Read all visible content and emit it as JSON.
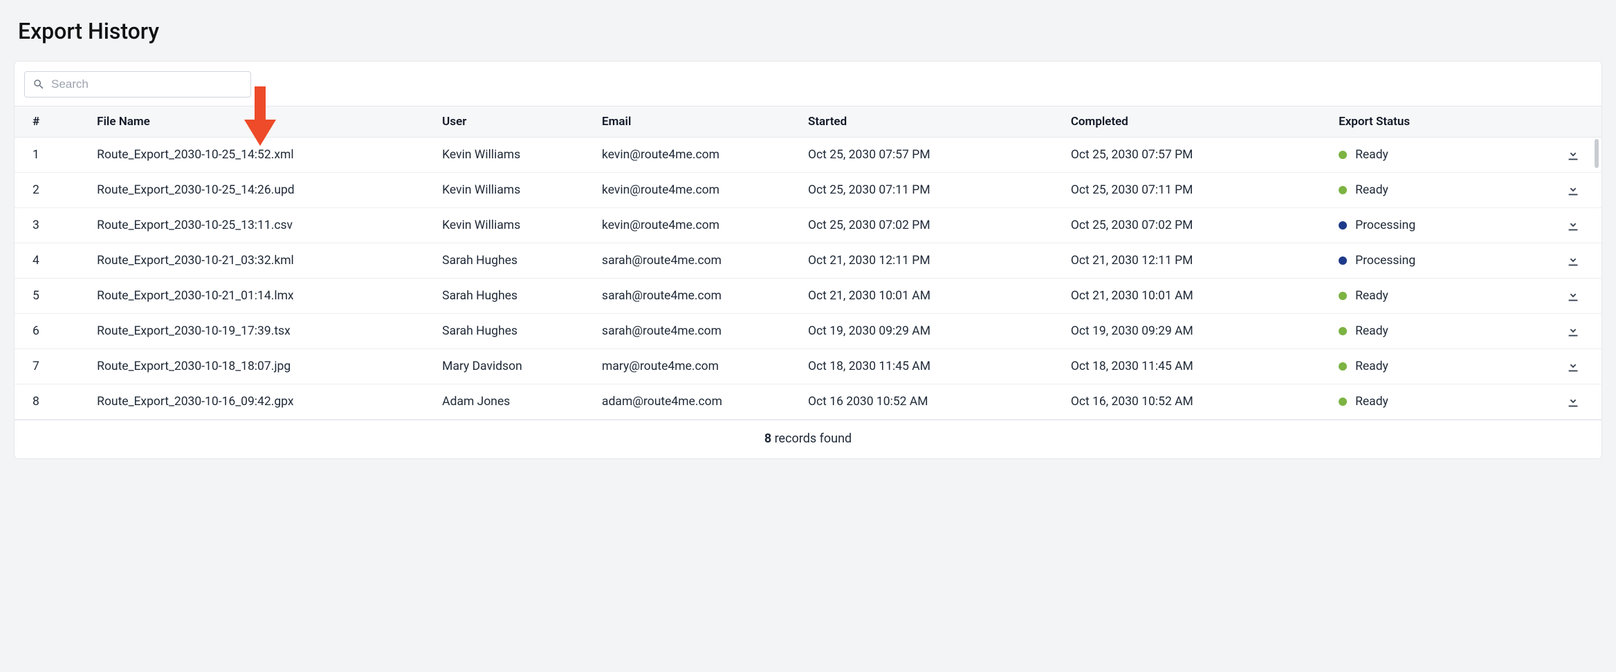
{
  "page_title": "Export History",
  "search": {
    "placeholder": "Search"
  },
  "columns": {
    "idx": "#",
    "file": "File Name",
    "user": "User",
    "email": "Email",
    "started": "Started",
    "completed": "Completed",
    "status": "Export Status"
  },
  "status_colors": {
    "Ready": "#7cb342",
    "Processing": "#1e3a8a"
  },
  "rows": [
    {
      "idx": "1",
      "file": "Route_Export_2030-10-25_14:52.xml",
      "user": "Kevin Williams",
      "email": "kevin@route4me.com",
      "started": "Oct 25, 2030 07:57 PM",
      "completed": "Oct 25, 2030 07:57 PM",
      "status": "Ready"
    },
    {
      "idx": "2",
      "file": "Route_Export_2030-10-25_14:26.upd",
      "user": "Kevin Williams",
      "email": "kevin@route4me.com",
      "started": "Oct 25, 2030 07:11 PM",
      "completed": "Oct 25, 2030 07:11 PM",
      "status": "Ready"
    },
    {
      "idx": "3",
      "file": "Route_Export_2030-10-25_13:11.csv",
      "user": "Kevin Williams",
      "email": "kevin@route4me.com",
      "started": "Oct 25, 2030 07:02 PM",
      "completed": "Oct 25, 2030 07:02 PM",
      "status": "Processing"
    },
    {
      "idx": "4",
      "file": "Route_Export_2030-10-21_03:32.kml",
      "user": "Sarah Hughes",
      "email": "sarah@route4me.com",
      "started": "Oct 21, 2030 12:11 PM",
      "completed": "Oct 21, 2030 12:11 PM",
      "status": "Processing"
    },
    {
      "idx": "5",
      "file": "Route_Export_2030-10-21_01:14.lmx",
      "user": "Sarah Hughes",
      "email": "sarah@route4me.com",
      "started": "Oct 21, 2030 10:01 AM",
      "completed": "Oct 21, 2030 10:01 AM",
      "status": "Ready"
    },
    {
      "idx": "6",
      "file": "Route_Export_2030-10-19_17:39.tsx",
      "user": "Sarah Hughes",
      "email": "sarah@route4me.com",
      "started": "Oct 19, 2030 09:29 AM",
      "completed": "Oct 19, 2030 09:29 AM",
      "status": "Ready"
    },
    {
      "idx": "7",
      "file": "Route_Export_2030-10-18_18:07.jpg",
      "user": "Mary Davidson",
      "email": "mary@route4me.com",
      "started": "Oct 18, 2030 11:45 AM",
      "completed": "Oct 18, 2030 11:45 AM",
      "status": "Ready"
    },
    {
      "idx": "8",
      "file": "Route_Export_2030-10-16_09:42.gpx",
      "user": "Adam Jones",
      "email": "adam@route4me.com",
      "started": "Oct 16 2030 10:52 AM",
      "completed": "Oct 16, 2030 10:52 AM",
      "status": "Ready"
    }
  ],
  "footer": {
    "count": "8",
    "suffix": " records found"
  }
}
